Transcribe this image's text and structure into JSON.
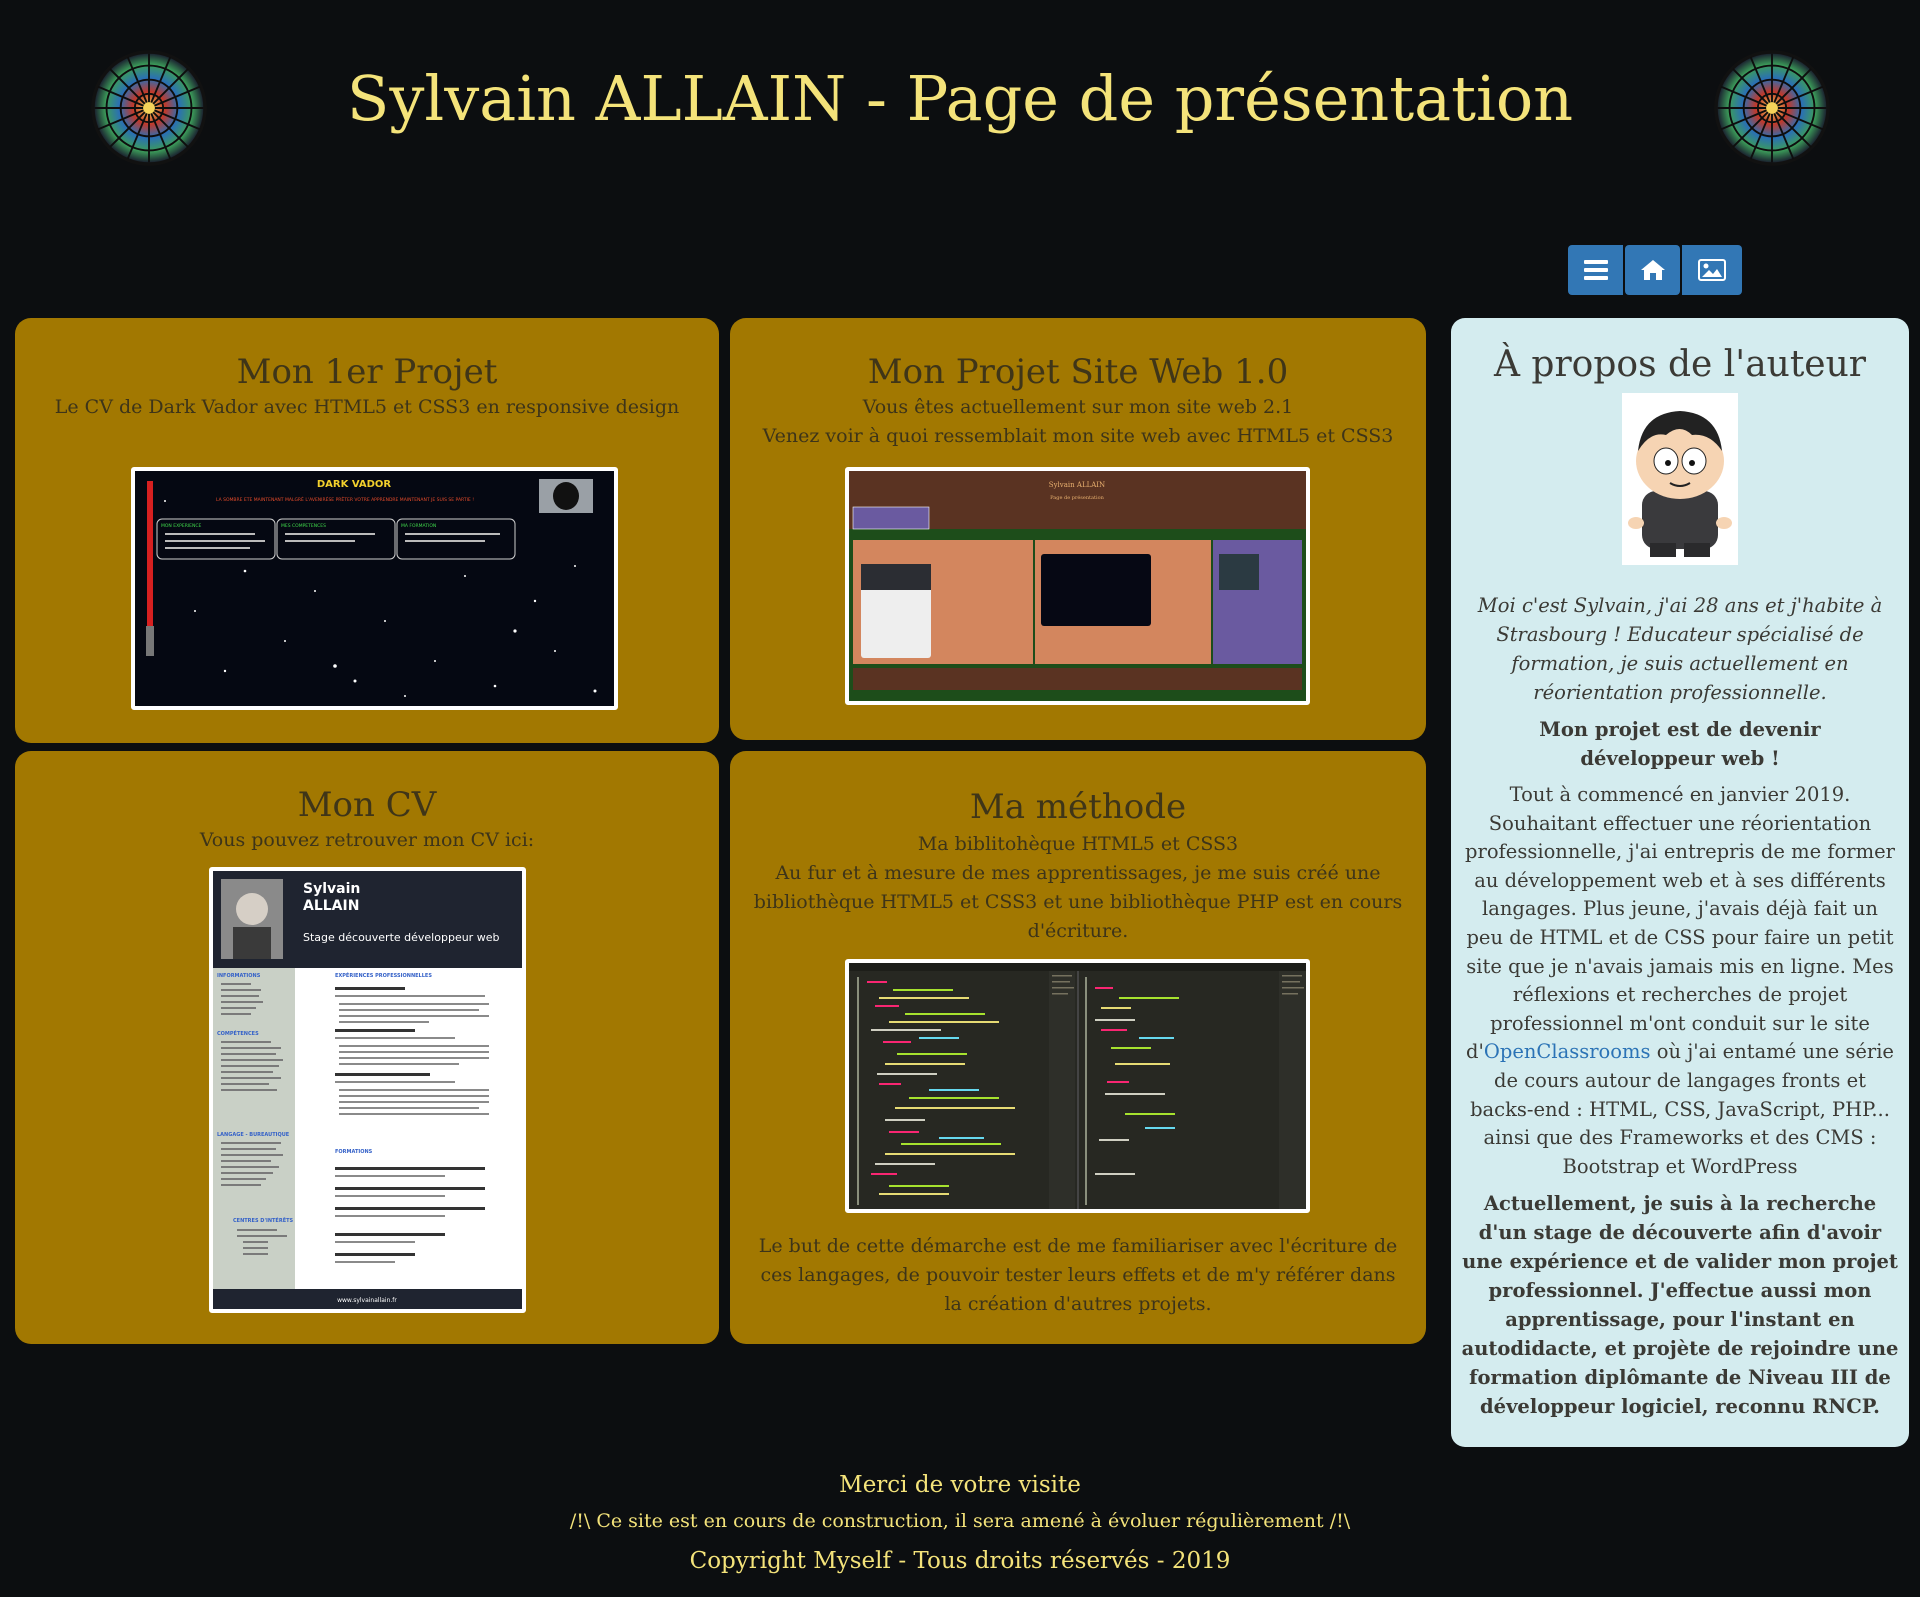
{
  "header": {
    "title": "Sylvain ALLAIN - Page de présentation",
    "left_logo_icon": "rose-window-icon",
    "right_logo_icon": "rose-window-icon"
  },
  "toolbar": {
    "buttons": [
      {
        "icon": "menu-icon"
      },
      {
        "icon": "home-icon"
      },
      {
        "icon": "image-icon"
      }
    ],
    "accent": "#3277b5"
  },
  "projects": [
    {
      "title": "Mon 1er Projet",
      "lines": [
        "Le CV de Dark Vador avec HTML5 et CSS3 en responsive design"
      ],
      "thumb": {
        "title": "DARK VADOR",
        "subtitle": "LA SOMBRE ETE MAINTENANT MALGRÉ L'AVENIRÉSE PRÊTER VOTRE APPRENDRE MAINTENANT JE SUIS SE PARTIE !",
        "sections": [
          "MON EXPERIENCE",
          "MES COMPETENCES",
          "MA FORMATION"
        ]
      }
    },
    {
      "title": "Mon Projet Site Web 1.0",
      "lines": [
        "Vous êtes actuellement sur mon site web 2.1",
        "Venez voir à quoi ressemblait mon site web avec HTML5 et CSS3"
      ],
      "thumb": {
        "title": "Sylvain ALLAIN",
        "subtitle": "Page de présentation"
      }
    },
    {
      "title": "Mon CV",
      "lines": [
        "Vous pouvez retrouver mon CV ici:"
      ],
      "thumb": {
        "first_name": "Sylvain",
        "last_name": "ALLAIN",
        "role": "Stage découverte développeur web",
        "side_headings": [
          "INFORMATIONS",
          "COMPÉTENCES",
          "LANGAGE - BUREAUTIQUE",
          "CENTRES D'INTÉRÊTS"
        ],
        "main_headings": [
          "EXPÉRIENCES PROFESSIONNELLES",
          "FORMATIONS"
        ],
        "footer": "www.sylvainallain.fr"
      }
    },
    {
      "title": "Ma méthode",
      "lines": [
        "Ma biblitohèque HTML5 et CSS3",
        "Au fur et à mesure de mes apprentissages, je me suis créé une bibliothèque HTML5 et CSS3 et une bibliothèque PHP est en cours d'écriture."
      ],
      "after": "Le but de cette démarche est de me familiariser avec l'écriture de ces langages, de pouvoir tester leurs effets et de m'y référer dans la création d'autres projets."
    }
  ],
  "about": {
    "title": "À propos de l'auteur",
    "avatar_icon": "cartoon-avatar-icon",
    "intro": "Moi c'est Sylvain, j'ai 28 ans et j'habite à Strasbourg ! Educateur spécialisé de formation, je suis actuellement en réorientation professionnelle.",
    "goal": "Mon projet est de devenir développeur web !",
    "story_before": "Tout à commencé en janvier 2019. Souhaitant effectuer une réorientation professionnelle, j'ai entrepris de me former au développement web et à ses différents langages. Plus jeune, j'avais déjà fait un peu de HTML et de CSS pour faire un petit site que je n'avais jamais mis en ligne. Mes réflexions et recherches de projet professionnel m'ont conduit sur le site d'",
    "story_link": "OpenClassrooms",
    "story_after": " où j'ai entamé une série de cours autour de langages fronts et backs-end : HTML, CSS, JavaScript, PHP... ainsi que des Frameworks et des CMS : Bootstrap et WordPress",
    "closing": "Actuellement, je suis à la recherche d'un stage de découverte afin d'avoir une expérience et de valider mon projet professionnel. J'effectue aussi mon apprentissage, pour l'instant en autodidacte, et projète de rejoindre une formation diplômante de Niveau III de développeur logiciel, reconnu RNCP."
  },
  "footer": {
    "thanks": "Merci de votre visite",
    "notice": "/!\\ Ce site est en cours de construction, il sera amené à évoluer régulièrement /!\\",
    "copyright": "Copyright Myself - Tous droits réservés - 2019"
  },
  "colors": {
    "background": "#0c0e10",
    "title": "#f4e37a",
    "card": "#a27801",
    "about": "#d4ecef",
    "link": "#2b73b6"
  }
}
